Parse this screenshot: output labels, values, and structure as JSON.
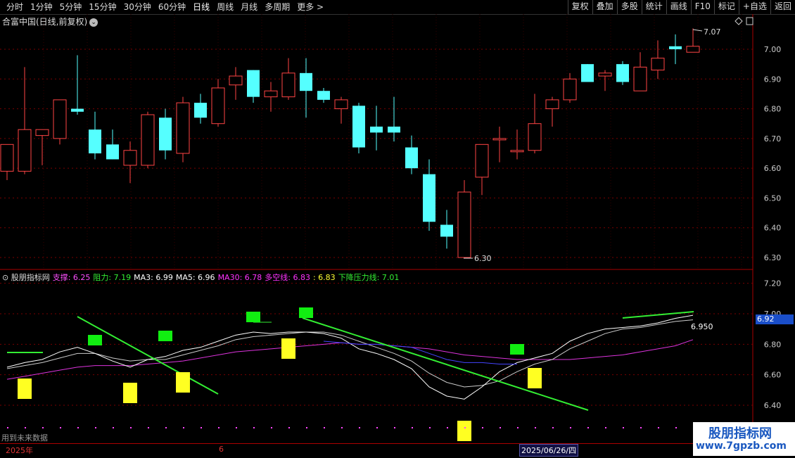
{
  "toolbar": {
    "periods": [
      "分时",
      "1分钟",
      "5分钟",
      "15分钟",
      "30分钟",
      "60分钟",
      "日线",
      "周线",
      "月线",
      "多周期",
      "更多 >"
    ],
    "active_period": "日线",
    "right_items": [
      "复权",
      "叠加",
      "多股",
      "统计",
      "画线",
      "F10",
      "标记",
      "+自选",
      "返回"
    ]
  },
  "main_chart": {
    "title": "合富中国(日线,前复权)",
    "y_ticks": [
      "7.00",
      "6.90",
      "6.80",
      "6.70",
      "6.60",
      "6.50",
      "6.40",
      "6.30"
    ],
    "high_label": "7.07",
    "low_label": "6.30",
    "candles": [
      {
        "o": 6.59,
        "c": 6.68,
        "h": 6.68,
        "l": 6.56
      },
      {
        "o": 6.59,
        "c": 6.73,
        "h": 6.94,
        "l": 6.58
      },
      {
        "o": 6.71,
        "c": 6.73,
        "h": 6.73,
        "l": 6.61
      },
      {
        "o": 6.7,
        "c": 6.83,
        "h": 6.83,
        "l": 6.68
      },
      {
        "o": 6.8,
        "c": 6.79,
        "h": 6.98,
        "l": 6.78
      },
      {
        "o": 6.73,
        "c": 6.65,
        "h": 6.79,
        "l": 6.63
      },
      {
        "o": 6.68,
        "c": 6.63,
        "h": 6.73,
        "l": 6.63
      },
      {
        "o": 6.61,
        "c": 6.66,
        "h": 6.69,
        "l": 6.55
      },
      {
        "o": 6.61,
        "c": 6.78,
        "h": 6.79,
        "l": 6.6
      },
      {
        "o": 6.77,
        "c": 6.66,
        "h": 6.8,
        "l": 6.63
      },
      {
        "o": 6.65,
        "c": 6.82,
        "h": 6.84,
        "l": 6.62
      },
      {
        "o": 6.82,
        "c": 6.77,
        "h": 6.85,
        "l": 6.75
      },
      {
        "o": 6.75,
        "c": 6.87,
        "h": 6.9,
        "l": 6.74
      },
      {
        "o": 6.88,
        "c": 6.91,
        "h": 6.94,
        "l": 6.83
      },
      {
        "o": 6.93,
        "c": 6.84,
        "h": 6.93,
        "l": 6.82
      },
      {
        "o": 6.84,
        "c": 6.86,
        "h": 6.89,
        "l": 6.79
      },
      {
        "o": 6.84,
        "c": 6.92,
        "h": 6.97,
        "l": 6.83
      },
      {
        "o": 6.92,
        "c": 6.86,
        "h": 6.97,
        "l": 6.77
      },
      {
        "o": 6.86,
        "c": 6.83,
        "h": 6.87,
        "l": 6.82
      },
      {
        "o": 6.8,
        "c": 6.83,
        "h": 6.84,
        "l": 6.75
      },
      {
        "o": 6.81,
        "c": 6.67,
        "h": 6.82,
        "l": 6.65
      },
      {
        "o": 6.74,
        "c": 6.72,
        "h": 6.81,
        "l": 6.66
      },
      {
        "o": 6.74,
        "c": 6.72,
        "h": 6.84,
        "l": 6.69
      },
      {
        "o": 6.67,
        "c": 6.6,
        "h": 6.71,
        "l": 6.58
      },
      {
        "o": 6.58,
        "c": 6.42,
        "h": 6.63,
        "l": 6.39
      },
      {
        "o": 6.41,
        "c": 6.37,
        "h": 6.46,
        "l": 6.33
      },
      {
        "o": 6.3,
        "c": 6.52,
        "h": 6.56,
        "l": 6.3
      },
      {
        "o": 6.57,
        "c": 6.68,
        "h": 6.68,
        "l": 6.51
      },
      {
        "o": 6.7,
        "c": 6.7,
        "h": 6.74,
        "l": 6.62
      },
      {
        "o": 6.66,
        "c": 6.66,
        "h": 6.73,
        "l": 6.63
      },
      {
        "o": 6.66,
        "c": 6.75,
        "h": 6.85,
        "l": 6.65
      },
      {
        "o": 6.8,
        "c": 6.83,
        "h": 6.84,
        "l": 6.74
      },
      {
        "o": 6.83,
        "c": 6.9,
        "h": 6.92,
        "l": 6.82
      },
      {
        "o": 6.95,
        "c": 6.89,
        "h": 6.95,
        "l": 6.89
      },
      {
        "o": 6.91,
        "c": 6.92,
        "h": 6.93,
        "l": 6.86
      },
      {
        "o": 6.95,
        "c": 6.89,
        "h": 6.96,
        "l": 6.88
      },
      {
        "o": 6.86,
        "c": 6.94,
        "h": 6.99,
        "l": 6.86
      },
      {
        "o": 6.93,
        "c": 6.97,
        "h": 7.03,
        "l": 6.9
      },
      {
        "o": 7.01,
        "c": 7.0,
        "h": 7.05,
        "l": 6.95
      },
      {
        "o": 6.99,
        "c": 7.01,
        "h": 7.07,
        "l": 6.99
      }
    ]
  },
  "indicator": {
    "name": "股朋指标网",
    "items": [
      {
        "label": "支撑: 6.25",
        "color": "#ff4fff"
      },
      {
        "label": "阻力: 7.19",
        "color": "#33ee33"
      },
      {
        "label": "MA3: 6.99",
        "color": "#ffffff"
      },
      {
        "label": "MA5: 6.96",
        "color": "#ffffff"
      },
      {
        "label": "MA30: 6.78",
        "color": "#ff33ff"
      },
      {
        "label": "多空线: 6.83",
        "color": "#ff33ff"
      },
      {
        "label": ": 6.83",
        "color": "#ffff33"
      },
      {
        "label": "下降压力线: 7.01",
        "color": "#33ee33"
      }
    ],
    "y_ticks": [
      "7.20",
      "7.00",
      "6.80",
      "6.60",
      "6.40"
    ],
    "value_label": "6.950",
    "price_tag": "6.92"
  },
  "footer": {
    "future_note": "用到未来数据",
    "year_label": "2025年",
    "month_label": "6",
    "date_label": "2025/06/26/四"
  },
  "logo": {
    "line1": "股朋指标网",
    "line2": "www.7gpzb.com"
  },
  "colors": {
    "up": "#ff4444",
    "down": "#55ffff",
    "grid": "#7a0000"
  }
}
